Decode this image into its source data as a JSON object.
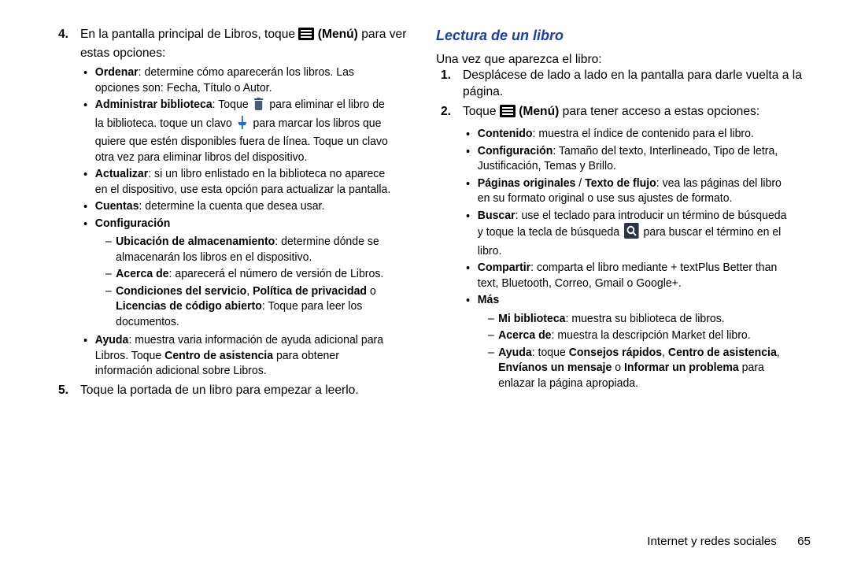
{
  "left": {
    "step4": {
      "num": "4.",
      "lead_a": "En la pantalla principal de Libros, toque",
      "menu_after": "(Menú)",
      "lead_b": "para ver estas opciones:",
      "b_ordenar": "Ordenar",
      "b_ordenar_t": ": determine cómo aparecerán los libros. Las opciones son: Fecha, Título o Autor.",
      "b_admin": "Administrar biblioteca",
      "b_admin_t1": ": Toque",
      "b_admin_t2": "para eliminar el libro de la biblioteca. toque un clavo",
      "b_admin_t3": "para marcar los libros que quiere que estén disponibles fuera de línea. Toque un clavo otra vez para eliminar libros del dispositivo.",
      "b_act": "Actualizar",
      "b_act_t": ": si un libro enlistado en la biblioteca no aparece en el dispositivo, use esta opción para actualizar la pantalla.",
      "b_cuentas": "Cuentas",
      "b_cuentas_t": ": determine la cuenta que desea usar.",
      "b_conf": "Configuración",
      "d_ubic_b": "Ubicación de almacenamiento",
      "d_ubic_t": ": determine dónde se almacenarán los libros en el dispositivo.",
      "d_acerca_b": "Acerca de",
      "d_acerca_t": ": aparecerá el número de versión de Libros.",
      "d_cond_b1": "Condiciones del servicio",
      "d_cond_sep": ", ",
      "d_cond_b2": "Política de privacidad",
      "d_cond_mid": " o ",
      "d_cond_b3": "Licencias de código abierto",
      "d_cond_t": ": Toque para leer los documentos.",
      "b_ayuda": "Ayuda",
      "b_ayuda_t1": ": muestra varia información de ayuda adicional para Libros. Toque ",
      "b_ayuda_b2": "Centro de asistencia",
      "b_ayuda_t2": " para obtener información adicional sobre Libros."
    },
    "step5": {
      "num": "5.",
      "text": "Toque la portada de un libro para empezar a leerlo."
    }
  },
  "right": {
    "heading": "Lectura de un libro",
    "intro": "Una vez que aparezca el libro:",
    "s1": {
      "num": "1.",
      "text": "Desplácese de lado a lado en la pantalla para darle vuelta a la página."
    },
    "s2": {
      "num": "2.",
      "lead_a": "Toque",
      "menu_after": "(Menú)",
      "lead_b": "para tener acceso a estas opciones:",
      "b_cont": "Contenido",
      "b_cont_t": ": muestra el índice de contenido para el libro.",
      "b_conf": "Configuración",
      "b_conf_t": ": Tamaño del texto, Interlineado, Tipo de letra, Justificación, Temas y Brillo.",
      "b_pag_b1": "Páginas originales",
      "b_pag_sep": " / ",
      "b_pag_b2": "Texto de flujo",
      "b_pag_t": ": vea las páginas del libro en su formato original o use sus ajustes de formato.",
      "b_buscar": "Buscar",
      "b_buscar_t1": ": use el teclado para introducir un término de búsqueda y toque la tecla de búsqueda",
      "b_buscar_t2": "para buscar el término en el libro.",
      "b_comp": "Compartir",
      "b_comp_t": ": comparta el libro mediante + textPlus Better than text, Bluetooth, Correo, Gmail o Google+.",
      "b_mas": "Más",
      "d_mibib_b": "Mi biblioteca",
      "d_mibib_t": ": muestra su biblioteca de libros.",
      "d_acerca_b": "Acerca de",
      "d_acerca_t": ": muestra la descripción Market del libro.",
      "d_ayuda_b": "Ayuda",
      "d_ayuda_t1": ": toque ",
      "d_ayuda_b2": "Consejos rápidos",
      "d_ayuda_sep": ", ",
      "d_ayuda_b3": "Centro de asistencia",
      "d_ayuda_sep2": ", ",
      "d_ayuda_b4": "Envíanos un mensaje",
      "d_ayuda_or": " o ",
      "d_ayuda_b5": "Informar un problema",
      "d_ayuda_t2": " para enlazar la página apropiada."
    }
  },
  "footer": {
    "section": "Internet y redes sociales",
    "page": "65"
  }
}
